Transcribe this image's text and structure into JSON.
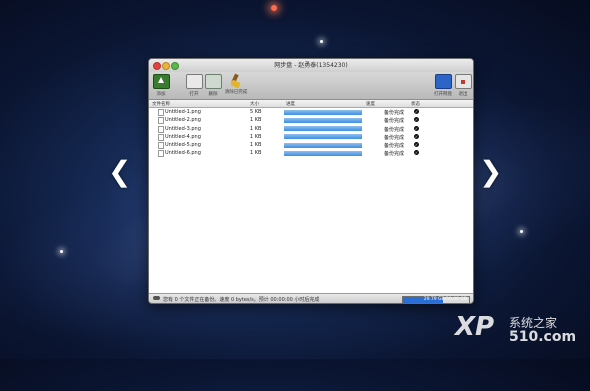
{
  "window": {
    "title": "网步盘 - 赵勇泰(1354230)"
  },
  "toolbar": {
    "add_label": "添加",
    "open_label": "打开",
    "delete_label": "删除",
    "clear_label": "清除已完成",
    "site_label": "打开网盘",
    "exit_label": "退出"
  },
  "columns": {
    "name": "文件名称",
    "size": "大小",
    "progress": "进度",
    "speed": "速度",
    "status": "状态"
  },
  "files": [
    {
      "name": "Untitled-1.png",
      "size": "5 KB",
      "progress": 1.0,
      "status": "备份完成"
    },
    {
      "name": "Untitled-2.png",
      "size": "1 KB",
      "progress": 1.0,
      "status": "备份完成"
    },
    {
      "name": "Untitled-3.png",
      "size": "1 KB",
      "progress": 1.0,
      "status": "备份完成"
    },
    {
      "name": "Untitled-4.png",
      "size": "1 KB",
      "progress": 1.0,
      "status": "备份完成"
    },
    {
      "name": "Untitled-5.png",
      "size": "1 KB",
      "progress": 1.0,
      "status": "备份完成"
    },
    {
      "name": "Untitled-6.png",
      "size": "1 KB",
      "progress": 1.0,
      "status": "备份完成"
    }
  ],
  "statusbar": {
    "text": "您有 0 个文件正在备份。速度 0 bytes/s。预计 00:00:00 小时后完成",
    "quota_text": "29.79 GB/50.00 GB",
    "quota_fraction": 0.6
  },
  "watermark": {
    "brand": "XP",
    "name": "系统之家",
    "number": "510.com"
  },
  "colors": {
    "progress_blue": "#3d8ee0",
    "quota_blue": "#2a6fd8"
  }
}
